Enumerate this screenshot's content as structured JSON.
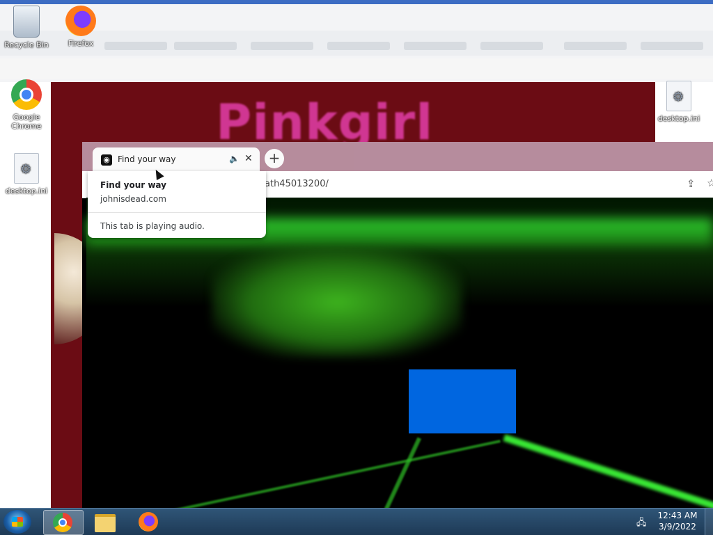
{
  "desktop": {
    "icons": [
      {
        "label": "Recycle Bin",
        "icon": "recycle-bin-icon"
      },
      {
        "label": "Firefox",
        "icon": "firefox-icon"
      },
      {
        "label": "Google Chrome",
        "icon": "chrome-icon"
      },
      {
        "label": "desktop.ini",
        "icon": "settings-file-icon"
      },
      {
        "label": "desktop.ini",
        "icon": "settings-file-icon"
      }
    ]
  },
  "background_page": {
    "title": "Pinkgirl"
  },
  "browser": {
    "active_tab": {
      "title": "Find your way",
      "favicon": "site-favicon",
      "audio_icon": "speaker-icon",
      "close_icon": "close-icon"
    },
    "new_tab_icon": "plus-icon",
    "url_fragment": "ath45013200/",
    "toolbar_icons": [
      "share-icon",
      "star-icon"
    ],
    "hover_card": {
      "title": "Find your way",
      "domain": "johnisdead.com",
      "status": "This tab is playing audio."
    },
    "content_colors": {
      "glow": "#39ff3a",
      "overlay_rect": "#0066e0"
    }
  },
  "taskbar": {
    "items": [
      "start-button",
      "chrome-taskbar-button",
      "file-explorer-taskbar-button",
      "firefox-taskbar-button"
    ],
    "clock": {
      "time": "12:43 AM",
      "date": "3/9/2022"
    },
    "tray_icon": "network-icon"
  },
  "colors": {
    "taskbar": "#1e3a56",
    "background_page": "#6b0c14",
    "pink_title": "#e23ea8"
  }
}
